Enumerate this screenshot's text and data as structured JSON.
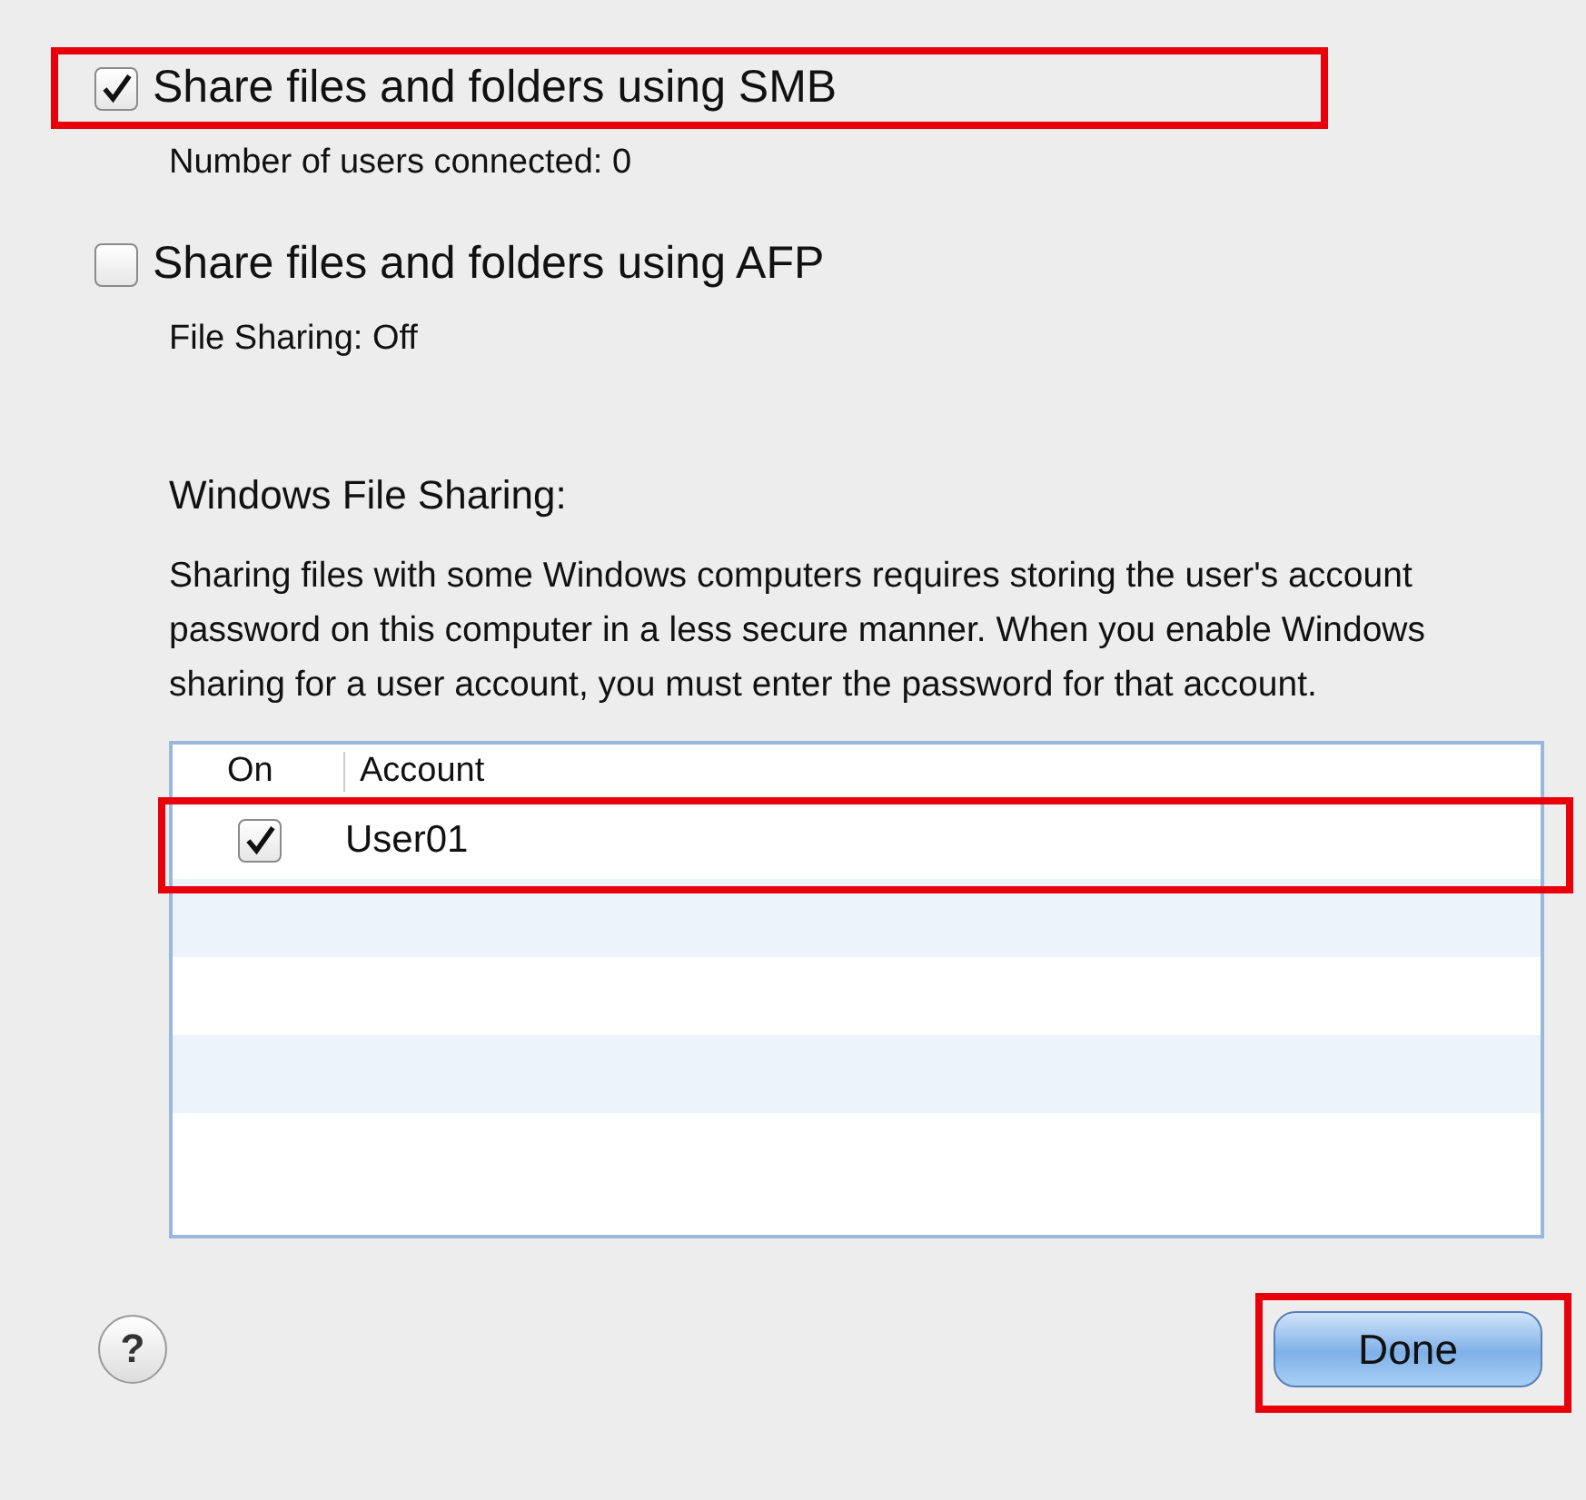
{
  "options": [
    {
      "label": "Share files and folders using SMB",
      "checked": true,
      "highlighted": true,
      "status": "Number of users connected: 0"
    },
    {
      "label": "Share files and folders using AFP",
      "checked": false,
      "highlighted": false,
      "status": "File Sharing: Off"
    }
  ],
  "windows_sharing": {
    "heading": "Windows File Sharing:",
    "description": "Sharing files with some Windows computers requires storing the user's account password on this computer in a less secure manner.  When you enable Windows sharing for a user account, you must enter the password for that account."
  },
  "table": {
    "columns": [
      "On",
      "Account"
    ],
    "rows": [
      {
        "account": "User01",
        "checked": true,
        "highlighted": true
      }
    ]
  },
  "help_button": {
    "label": "?"
  },
  "done_button": {
    "label": "Done",
    "highlighted": true
  }
}
